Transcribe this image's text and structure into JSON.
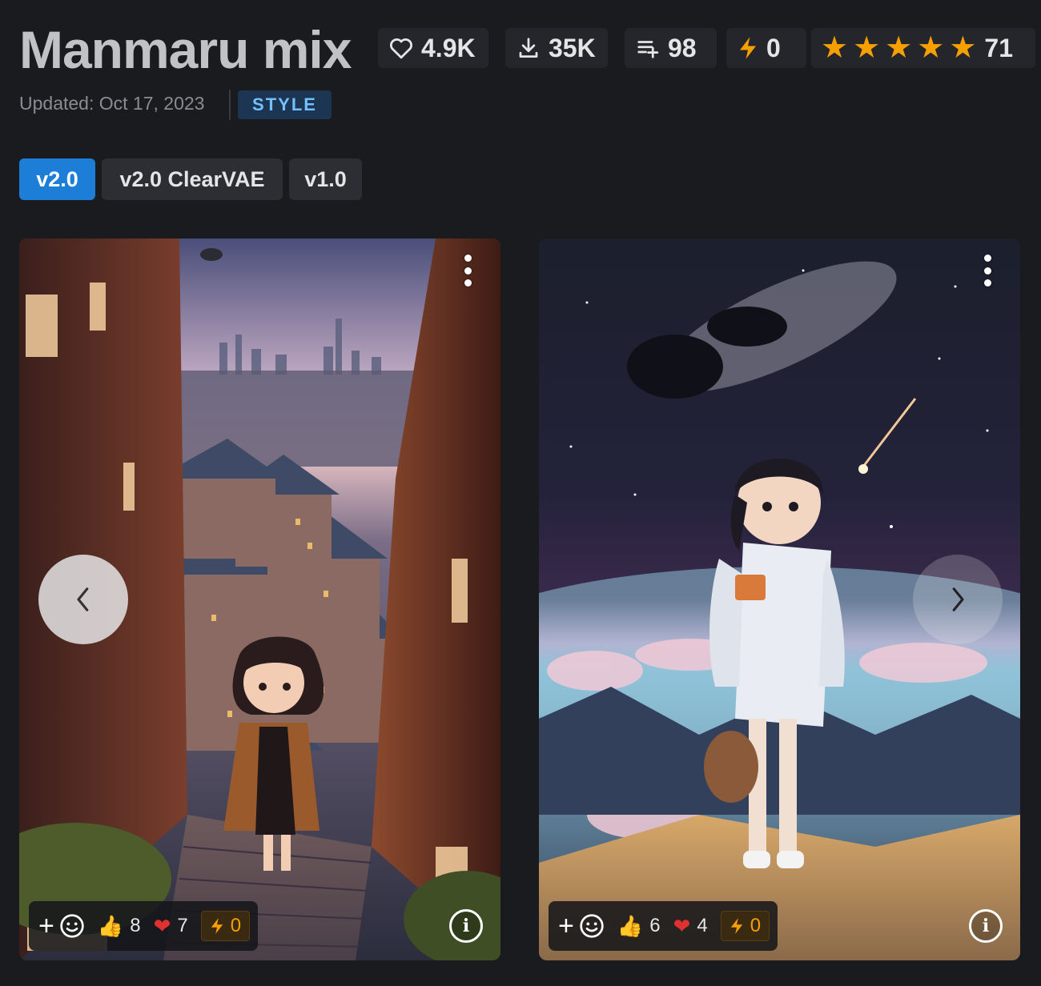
{
  "model": {
    "title": "Manmaru mix",
    "updated": "Updated: Oct 17, 2023",
    "type_badge": "STYLE"
  },
  "stats": {
    "likes": "4.9K",
    "downloads": "35K",
    "collections": "98",
    "buzz": "0",
    "rating_stars": 5,
    "rating_count": "71"
  },
  "versions": [
    {
      "label": "v2.0",
      "active": true
    },
    {
      "label": "v2.0 ClearVAE",
      "active": false
    },
    {
      "label": "v1.0",
      "active": false
    }
  ],
  "gallery": {
    "images": [
      {
        "reactions": {
          "thumbs_up": "8",
          "hearts": "7",
          "buzz": "0"
        }
      },
      {
        "reactions": {
          "thumbs_up": "6",
          "hearts": "4",
          "buzz": "0"
        }
      }
    ]
  },
  "colors": {
    "background": "#1a1b1e",
    "accent": "#1c7ed6",
    "star": "#f59f00",
    "badge_text": "#74c0fc"
  }
}
